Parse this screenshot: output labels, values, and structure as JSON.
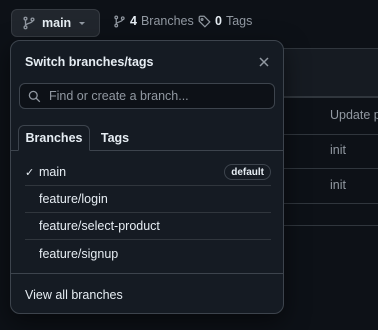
{
  "toolbar": {
    "branch_button_label": "main",
    "branches_count": "4",
    "branches_label": "Branches",
    "tags_count": "0",
    "tags_label": "Tags"
  },
  "background": {
    "commit_message_1": "Update p",
    "commit_message_2": "init",
    "commit_message_3": "init"
  },
  "dropdown": {
    "title": "Switch branches/tags",
    "search_placeholder": "Find or create a branch...",
    "tabs": [
      {
        "label": "Branches",
        "active": true
      },
      {
        "label": "Tags",
        "active": false
      }
    ],
    "branches": [
      {
        "name": "main",
        "selected": true,
        "badge": "default"
      },
      {
        "name": "feature/login",
        "selected": false,
        "badge": ""
      },
      {
        "name": "feature/select-product",
        "selected": false,
        "badge": ""
      },
      {
        "name": "feature/signup",
        "selected": false,
        "badge": ""
      }
    ],
    "view_all_label": "View all branches"
  },
  "colors": {
    "background": "#0d1117",
    "overlay": "#151b23",
    "text": "#e6edf3",
    "muted": "#9198a1",
    "border": "#3d444d"
  }
}
